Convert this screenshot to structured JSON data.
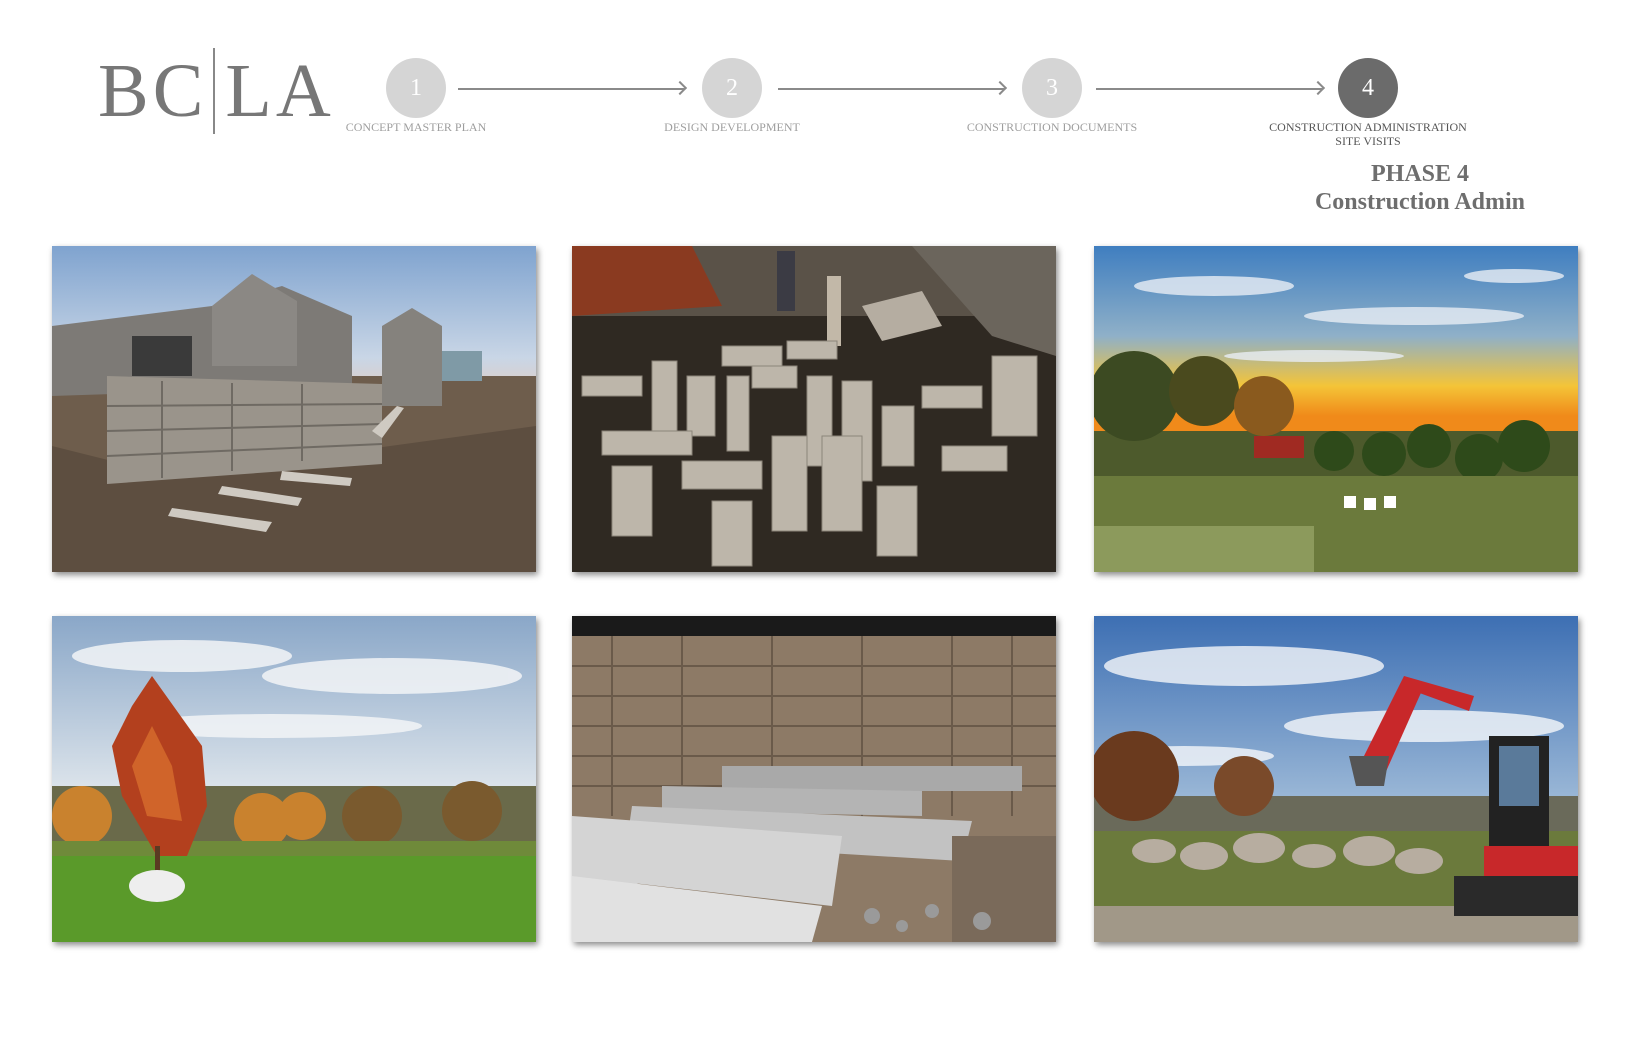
{
  "logo": {
    "left": "BC",
    "right": "LA"
  },
  "steps": [
    {
      "number": "1",
      "label": "CONCEPT MASTER PLAN",
      "state": "complete"
    },
    {
      "number": "2",
      "label": "DESIGN DEVELOPMENT",
      "state": "complete"
    },
    {
      "number": "3",
      "label": "CONSTRUCTION DOCUMENTS",
      "state": "complete"
    },
    {
      "number": "4",
      "label_line1": "CONSTRUCTION ADMINISTRATION",
      "label_line2": "SITE VISITS",
      "state": "current"
    }
  ],
  "phase": {
    "line1": "PHASE 4",
    "line2": "Construction Admin"
  },
  "photos": [
    {
      "subject": "stone house with stone retaining wall and stepping stones"
    },
    {
      "subject": "granite stone slabs laid out on soil with workers"
    },
    {
      "subject": "sunset over nursery plants and boxwoods"
    },
    {
      "subject": "red maple tree in root ball on lawn with fall foliage"
    },
    {
      "subject": "granite slab steps against stone veneer wall"
    },
    {
      "subject": "red mini excavator and boulder wall under blue sky"
    }
  ],
  "colors": {
    "step_complete": "#d5d5d5",
    "step_current": "#6b6b6b",
    "label_text": "#9e9e9e",
    "phase_text": "#6e6e6e"
  }
}
